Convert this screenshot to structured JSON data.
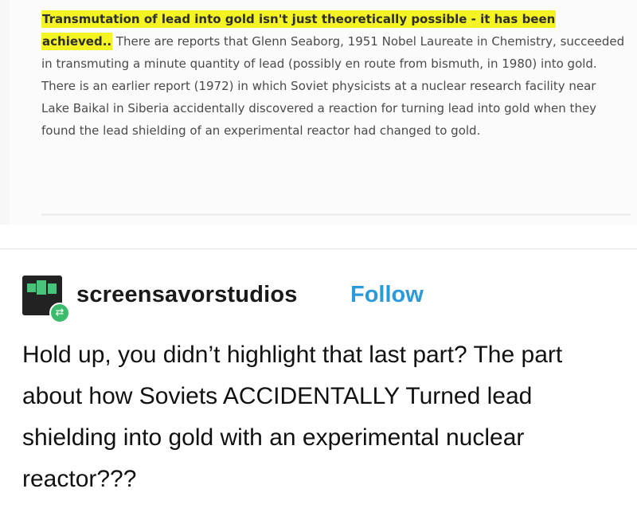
{
  "quote": {
    "highlighted_text": "Transmutation of lead into gold isn't just theoretically possible - it has been achieved..",
    "body_text": "There are reports that Glenn Seaborg, 1951 Nobel Laureate in Chemistry, succeeded in transmuting a minute quantity of lead (possibly en route from bismuth, in 1980) into gold. There is an earlier report (1972) in which Soviet physicists at a nuclear research facility near Lake Baikal in Siberia accidentally discovered a reaction for turning lead into gold when they found the lead shielding of an experimental reactor had changed to gold.",
    "highlight_color": "#f4f423"
  },
  "post": {
    "username": "screensavorstudios",
    "follow_label": "Follow",
    "follow_color": "#2a9ad8",
    "avatar_icon": "screensavor-logo-icon",
    "badge_icon": "reblog-icon",
    "badge_glyph": "⇄",
    "body": "Hold up, you didn’t highlight that last part?  The part about how Soviets ACCIDENTALLY Turned lead shielding into gold with an experimental nuclear reactor???"
  }
}
